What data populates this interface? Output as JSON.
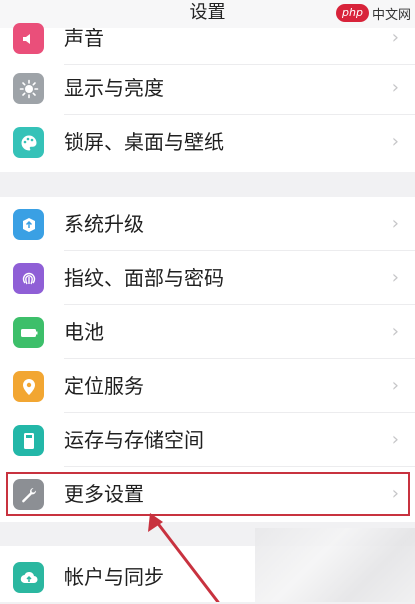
{
  "header": {
    "title": "设置"
  },
  "watermark": {
    "brand": "php",
    "text": "中文网"
  },
  "groups": {
    "g1": [
      {
        "label": "声音",
        "icon": "sound-icon",
        "color": "#ea4f7a"
      },
      {
        "label": "显示与亮度",
        "icon": "brightness-icon",
        "color": "#9ea3a8"
      },
      {
        "label": "锁屏、桌面与壁纸",
        "icon": "palette-icon",
        "color": "#35c2b8"
      }
    ],
    "g2": [
      {
        "label": "系统升级",
        "icon": "system-update-icon",
        "color": "#3aa0e4"
      },
      {
        "label": "指纹、面部与密码",
        "icon": "fingerprint-icon",
        "color": "#8f5fd6"
      },
      {
        "label": "电池",
        "icon": "battery-icon",
        "color": "#3dbf6a"
      },
      {
        "label": "定位服务",
        "icon": "location-icon",
        "color": "#f2a632"
      },
      {
        "label": "运存与存储空间",
        "icon": "storage-icon",
        "color": "#23b7a8"
      },
      {
        "label": "更多设置",
        "icon": "wrench-icon",
        "color": "#8c8f94"
      }
    ],
    "g3": [
      {
        "label": "帐户与同步",
        "icon": "cloud-sync-icon",
        "color": "#2bb7a0"
      }
    ]
  },
  "chevron": "›",
  "annotation_color": "#c8323f"
}
